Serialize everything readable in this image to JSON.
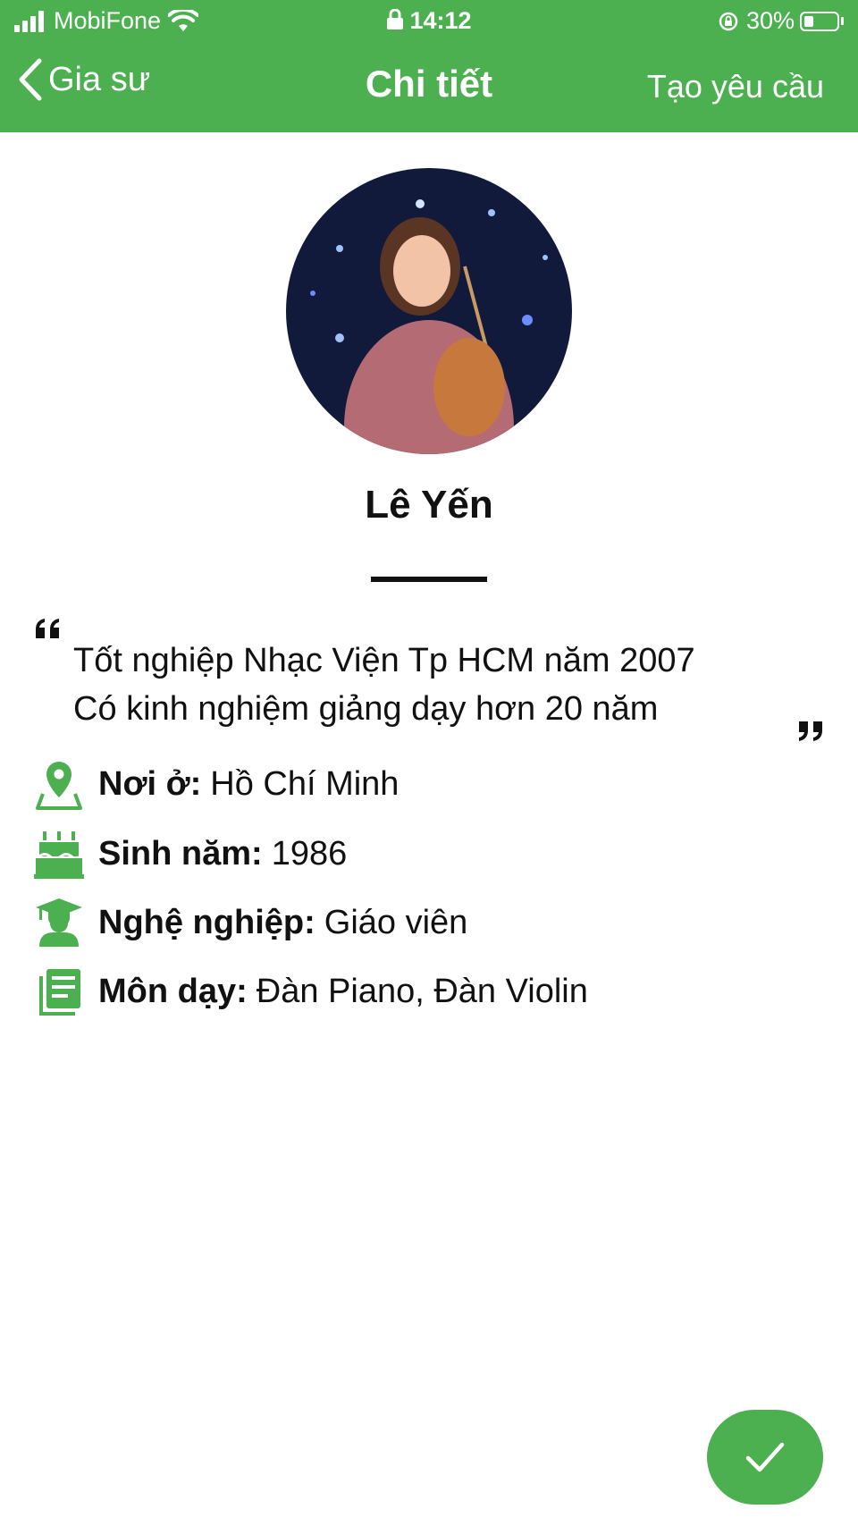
{
  "status_bar": {
    "carrier": "MobiFone",
    "time": "14:12",
    "battery": "30%"
  },
  "nav": {
    "back_label": "Gia sư",
    "title": "Chi tiết",
    "action_label": "Tạo yêu cầu"
  },
  "profile": {
    "name": "Lê Yến",
    "bio_lines": [
      "Tốt nghiệp Nhạc Viện Tp HCM năm 2007",
      "Có kinh nghiệm giảng dạy hơn 20 năm"
    ],
    "info": [
      {
        "icon": "location-pin-icon",
        "label": "Nơi ở:",
        "value": "Hồ Chí Minh"
      },
      {
        "icon": "birthday-cake-icon",
        "label": "Sinh năm:",
        "value": "1986"
      },
      {
        "icon": "graduate-icon",
        "label": "Nghệ nghiệp:",
        "value": "Giáo viên"
      },
      {
        "icon": "book-icon",
        "label": "Môn dạy:",
        "value": "Đàn Piano, Đàn Violin"
      }
    ]
  },
  "colors": {
    "accent": "#4caf50",
    "text": "#111111",
    "background": "#ffffff"
  }
}
